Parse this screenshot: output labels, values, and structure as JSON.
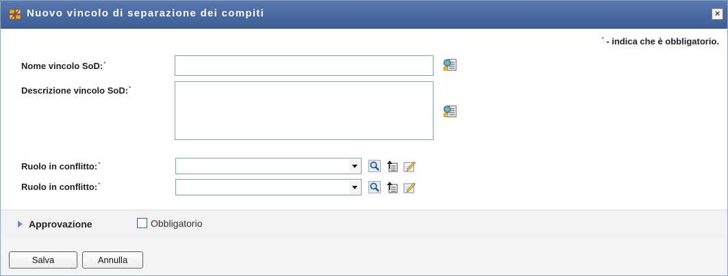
{
  "dialog": {
    "title": "Nuovo vincolo di separazione dei compiti",
    "close_glyph": "×"
  },
  "required_note": {
    "star": "*",
    "text": " - indica che è obbligatorio."
  },
  "form": {
    "name_label": "Nome vincolo SoD:",
    "name_value": "",
    "description_label": "Descrizione vincolo SoD:",
    "description_value": "",
    "required_star": "*",
    "conflict_roles": [
      {
        "label": "Ruolo in conflitto:",
        "value": ""
      },
      {
        "label": "Ruolo in conflitto:",
        "value": ""
      }
    ]
  },
  "approval": {
    "label": "Approvazione",
    "checkbox_label": "Obbligatorio",
    "checked": false
  },
  "buttons": {
    "save": "Salva",
    "cancel": "Annulla"
  },
  "icons": {
    "title": "role-sod-icon",
    "localize": "localize-icon",
    "search": "search-icon",
    "history": "history-icon",
    "edit": "edit-icon"
  },
  "colors": {
    "titlebar": "#4a6aa2",
    "approval_bar": "#f2f2f2",
    "footer": "#f4f4f4"
  }
}
